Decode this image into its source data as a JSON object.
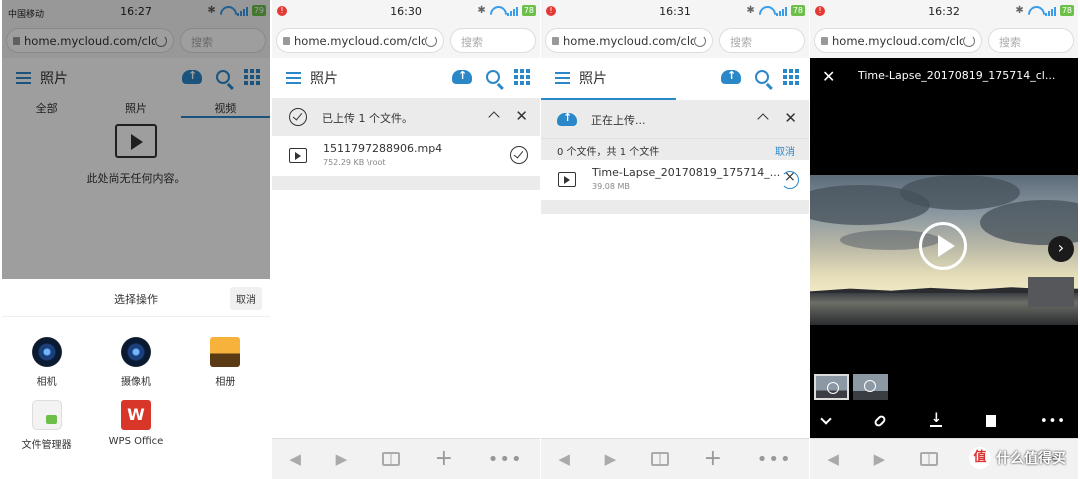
{
  "panel1": {
    "status": {
      "carrier": "中国移动",
      "time": "16:27",
      "battery": "79"
    },
    "url": "home.mycloud.com/clou",
    "search_placeholder": "搜索",
    "title": "照片",
    "tabs": [
      "全部",
      "照片",
      "视频"
    ],
    "empty_message": "此处尚无任何内容。",
    "sheet": {
      "title": "选择操作",
      "cancel": "取消",
      "apps": [
        {
          "label": "相机",
          "icon": "camera-icon"
        },
        {
          "label": "摄像机",
          "icon": "video-camera-icon"
        },
        {
          "label": "相册",
          "icon": "gallery-icon"
        },
        {
          "label": "文件管理器",
          "icon": "file-manager-icon"
        },
        {
          "label": "WPS Office",
          "icon": "wps-office-icon"
        }
      ]
    }
  },
  "panel2": {
    "status": {
      "time": "16:30",
      "battery": "78"
    },
    "url": "home.mycloud.com/clou",
    "search_placeholder": "搜索",
    "title": "照片",
    "banner": "已上传 1 个文件。",
    "file": {
      "name": "1511797288906.mp4",
      "meta": "752.29 KB \\root"
    }
  },
  "panel3": {
    "status": {
      "time": "16:31",
      "battery": "78"
    },
    "url": "home.mycloud.com/clou",
    "search_placeholder": "搜索",
    "title": "照片",
    "banner": "正在上传...",
    "counts": "0 个文件，共 1 个文件",
    "cancel": "取消",
    "file": {
      "name": "Time-Lapse_20170819_175714_...",
      "meta": "39.08 MB"
    }
  },
  "panel4": {
    "status": {
      "time": "16:32",
      "battery": "78"
    },
    "url": "home.mycloud.com/clou",
    "search_placeholder": "搜索",
    "viewer_title": "Time-Lapse_20170819_175714_cl...",
    "watermark": "什么值得买",
    "watermark_badge": "值"
  },
  "colors": {
    "accent": "#2a88c9",
    "upload_cancel": "#2a88c9",
    "status_dot": "#e53935"
  }
}
